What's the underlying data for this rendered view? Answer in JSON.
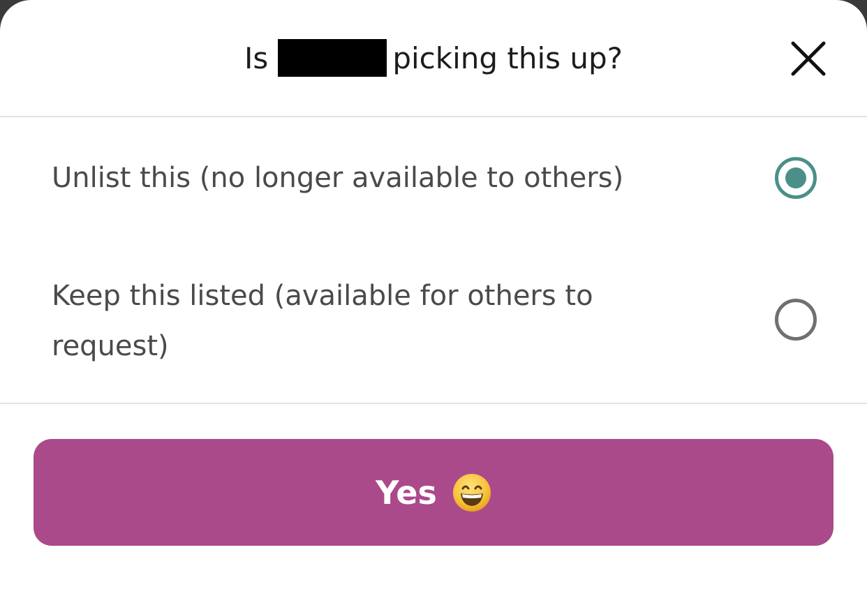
{
  "modal": {
    "title_prefix": "Is",
    "title_suffix": "picking this up?"
  },
  "options": [
    {
      "label": "Unlist this (no longer available to others)",
      "selected": true
    },
    {
      "label": "Keep this listed (available for others to request)",
      "selected": false
    }
  ],
  "actions": {
    "confirm_label": "Yes",
    "confirm_emoji": "grinning-face-icon",
    "close_icon": "close-icon"
  },
  "colors": {
    "accent_teal": "#4a9088",
    "button_magenta": "#ab4a8a",
    "text_dark": "#1c1c1c",
    "text_body": "#4a4a4a"
  }
}
